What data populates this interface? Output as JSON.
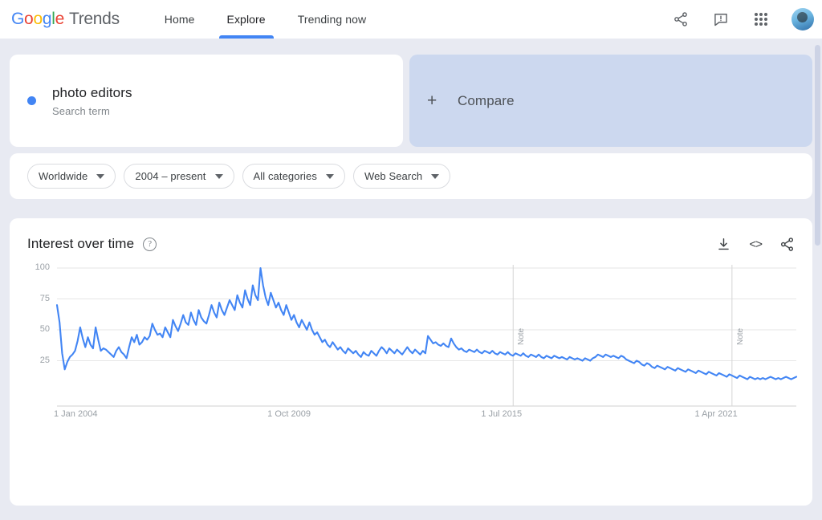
{
  "header": {
    "logo": {
      "word": "Google",
      "product": "Trends"
    },
    "nav": [
      {
        "label": "Home",
        "active": false
      },
      {
        "label": "Explore",
        "active": true
      },
      {
        "label": "Trending now",
        "active": false
      }
    ],
    "icons": [
      {
        "name": "share-icon",
        "glyph": "share"
      },
      {
        "name": "feedback-icon",
        "glyph": "feedback"
      },
      {
        "name": "apps-grid-icon",
        "glyph": "grid"
      },
      {
        "name": "avatar",
        "glyph": "avatar"
      }
    ]
  },
  "search_term": {
    "term": "photo editors",
    "type_label": "Search term",
    "dot_color": "#4285f4"
  },
  "compare": {
    "label": "Compare",
    "plus": "+"
  },
  "filters": [
    {
      "name": "location",
      "value": "Worldwide"
    },
    {
      "name": "time-range",
      "value": "2004 – present"
    },
    {
      "name": "category",
      "value": "All categories"
    },
    {
      "name": "search-type",
      "value": "Web Search"
    }
  ],
  "chart_panel": {
    "title": "Interest over time",
    "help_glyph": "?",
    "tools": [
      {
        "name": "download-icon",
        "label": "Download"
      },
      {
        "name": "embed-icon",
        "label": "<>"
      },
      {
        "name": "share-icon",
        "label": "Share"
      }
    ]
  },
  "chart_data": {
    "type": "line",
    "title": "Interest over time",
    "xlabel": "",
    "ylabel": "",
    "ylim": [
      0,
      100
    ],
    "yticks": [
      25,
      50,
      75,
      100
    ],
    "grid": true,
    "legend": false,
    "line_color": "#4285f4",
    "xtick_labels": [
      "1 Jan 2004",
      "1 Oct 2009",
      "1 Jul 2015",
      "1 Apr 2021"
    ],
    "xtick_positions": [
      0,
      0.289,
      0.578,
      0.867
    ],
    "annotations": [
      {
        "label": "Note",
        "x": 0.617
      },
      {
        "label": "Note",
        "x": 0.913
      }
    ],
    "series": [
      {
        "name": "photo editors",
        "values": [
          70,
          56,
          31,
          18,
          24,
          28,
          30,
          33,
          41,
          52,
          43,
          36,
          44,
          38,
          35,
          52,
          42,
          33,
          35,
          34,
          32,
          30,
          28,
          33,
          36,
          32,
          30,
          27,
          36,
          44,
          40,
          46,
          38,
          40,
          44,
          42,
          45,
          55,
          50,
          46,
          47,
          44,
          52,
          48,
          44,
          58,
          53,
          49,
          55,
          62,
          56,
          54,
          64,
          58,
          54,
          66,
          60,
          57,
          55,
          62,
          70,
          64,
          60,
          72,
          66,
          62,
          68,
          74,
          70,
          66,
          78,
          72,
          68,
          82,
          75,
          70,
          86,
          78,
          74,
          100,
          86,
          76,
          70,
          80,
          74,
          68,
          72,
          66,
          62,
          70,
          64,
          58,
          62,
          56,
          52,
          58,
          54,
          50,
          56,
          50,
          46,
          48,
          44,
          40,
          42,
          38,
          36,
          40,
          37,
          34,
          36,
          33,
          31,
          35,
          33,
          31,
          33,
          30,
          28,
          32,
          30,
          29,
          33,
          31,
          29,
          33,
          36,
          34,
          31,
          35,
          33,
          31,
          34,
          32,
          30,
          33,
          36,
          33,
          31,
          34,
          32,
          30,
          33,
          31,
          45,
          42,
          39,
          40,
          38,
          37,
          39,
          37,
          36,
          43,
          39,
          36,
          34,
          35,
          33,
          32,
          34,
          33,
          32,
          34,
          32,
          31,
          33,
          32,
          31,
          33,
          31,
          30,
          32,
          31,
          30,
          32,
          30,
          29,
          31,
          30,
          29,
          31,
          29,
          28,
          30,
          29,
          28,
          30,
          28,
          27,
          29,
          28,
          27,
          29,
          28,
          27,
          28,
          27,
          26,
          28,
          27,
          26,
          27,
          26,
          25,
          27,
          26,
          25,
          27,
          28,
          30,
          29,
          28,
          30,
          29,
          28,
          29,
          28,
          27,
          29,
          28,
          26,
          25,
          24,
          23,
          25,
          24,
          22,
          21,
          23,
          22,
          20,
          19,
          21,
          20,
          19,
          18,
          20,
          19,
          18,
          17,
          19,
          18,
          17,
          16,
          18,
          17,
          16,
          15,
          17,
          16,
          15,
          14,
          16,
          15,
          14,
          13,
          15,
          14,
          13,
          12,
          14,
          13,
          12,
          11,
          13,
          12,
          11,
          10,
          12,
          11,
          10,
          11,
          10,
          11,
          10,
          11,
          12,
          11,
          10,
          11,
          10,
          11,
          12,
          11,
          10,
          11,
          12
        ]
      }
    ]
  }
}
